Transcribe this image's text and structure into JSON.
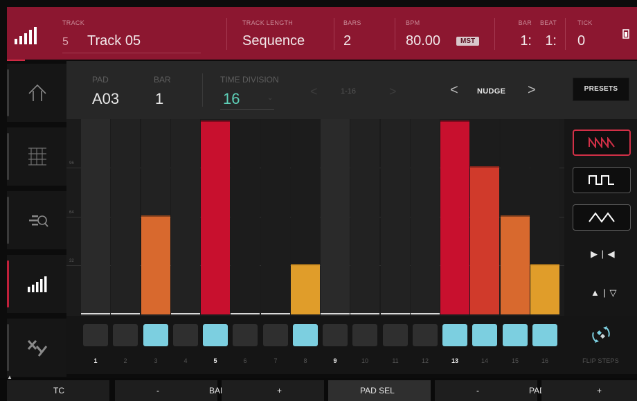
{
  "header": {
    "track_label": "TRACK",
    "track_number": "5",
    "track_name": "Track 05",
    "track_length_label": "TRACK LENGTH",
    "track_length_value": "Sequence",
    "bars_label": "BARS",
    "bars_value": "2",
    "bpm_label": "BPM",
    "bpm_value": "80.00",
    "mst_badge": "MST",
    "bar_label": "BAR",
    "bar_value": "1:",
    "beat_label": "BEAT",
    "beat_value": "1:",
    "tick_label": "TICK",
    "tick_value": "0"
  },
  "sidebar": {
    "items": [
      {
        "icon": "home-icon",
        "active": false
      },
      {
        "icon": "grid-icon",
        "active": false
      },
      {
        "icon": "track-zoom-icon",
        "active": false
      },
      {
        "icon": "velocity-bars-icon",
        "active": true
      },
      {
        "icon": "xy-icon",
        "active": false
      }
    ]
  },
  "subheader": {
    "pad_label": "PAD",
    "pad_value": "A03",
    "bar_label": "BAR",
    "bar_value": "1",
    "time_division_label": "TIME DIVISION",
    "time_division_value": "16",
    "range_prev": "<",
    "range": "1-16",
    "range_next": ">",
    "nudge_prev": "<",
    "nudge": "NUDGE",
    "nudge_next": ">",
    "presets": "PRESETS"
  },
  "graph": {
    "gridlines": [
      "96",
      "64",
      "32"
    ],
    "max": 127,
    "steps": [
      {
        "step": 1,
        "value": 0,
        "color": null
      },
      {
        "step": 2,
        "value": 0,
        "color": null
      },
      {
        "step": 3,
        "value": 65,
        "color": "#d8692e"
      },
      {
        "step": 4,
        "value": 0,
        "color": null
      },
      {
        "step": 5,
        "value": 127,
        "color": "#c8102e"
      },
      {
        "step": 6,
        "value": 0,
        "color": null
      },
      {
        "step": 7,
        "value": 0,
        "color": null
      },
      {
        "step": 8,
        "value": 33,
        "color": "#e09d2a"
      },
      {
        "step": 9,
        "value": 0,
        "color": null
      },
      {
        "step": 10,
        "value": 0,
        "color": null
      },
      {
        "step": 11,
        "value": 0,
        "color": null
      },
      {
        "step": 12,
        "value": 0,
        "color": null
      },
      {
        "step": 13,
        "value": 127,
        "color": "#c8102e"
      },
      {
        "step": 14,
        "value": 97,
        "color": "#d03a2b"
      },
      {
        "step": 15,
        "value": 65,
        "color": "#d8692e"
      },
      {
        "step": 16,
        "value": 33,
        "color": "#e09d2a"
      }
    ]
  },
  "tools": {
    "shapes": [
      "sawtooth-icon",
      "square-wave-icon",
      "triangle-wave-icon"
    ],
    "active_shape": "sawtooth-icon",
    "flip_horizontal": "▶ | ◀",
    "flip_vertical": "▲ | ▽"
  },
  "step_row": {
    "numbers": [
      "1",
      "2",
      "3",
      "4",
      "5",
      "6",
      "7",
      "8",
      "9",
      "10",
      "11",
      "12",
      "13",
      "14",
      "15",
      "16"
    ],
    "on": [
      3,
      5,
      8,
      13,
      14,
      15,
      16
    ],
    "bold_numbers": [
      1,
      5,
      9,
      13
    ],
    "flip_label": "FLIP STEPS"
  },
  "footer": {
    "tc": "TC",
    "bar_minus": "-",
    "bar": "BAR",
    "bar_plus": "+",
    "pad_sel": "PAD SEL",
    "pad_minus": "-",
    "pad": "PAD",
    "pad_plus": "+"
  },
  "colors": {
    "header": "#8c1730",
    "accent": "#d23047",
    "teal": "#5ed0b8",
    "step_on": "#7ccfe0"
  }
}
